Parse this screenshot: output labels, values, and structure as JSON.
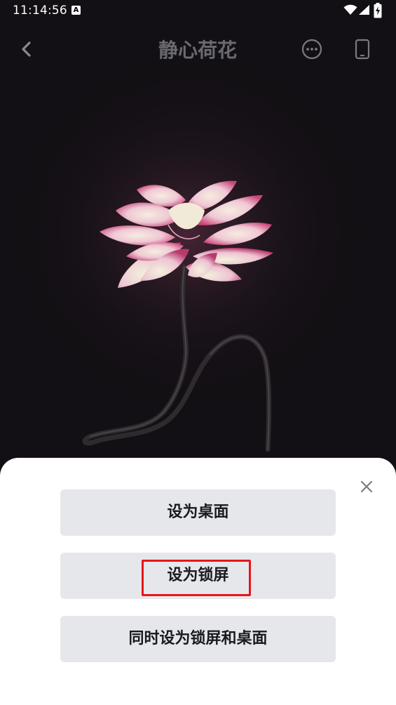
{
  "status_bar": {
    "time": "11:14:56",
    "notification_icon_letter": "A",
    "icons": [
      "wifi-icon",
      "signal-icon",
      "battery-charging-icon"
    ]
  },
  "header": {
    "title": "静心荷花",
    "back_icon": "chevron-left-icon",
    "more_icon": "more-circle-icon",
    "preview_icon": "phone-preview-icon"
  },
  "sheet": {
    "close_icon": "close-icon",
    "buttons": {
      "desktop": "设为桌面",
      "lockscreen": "设为锁屏",
      "both": "同时设为锁屏和桌面"
    }
  },
  "colors": {
    "accent_highlight": "#e8151b",
    "button_bg": "#e6e7eb",
    "sheet_bg": "#ffffff",
    "title_color": "#6a6a6e"
  }
}
